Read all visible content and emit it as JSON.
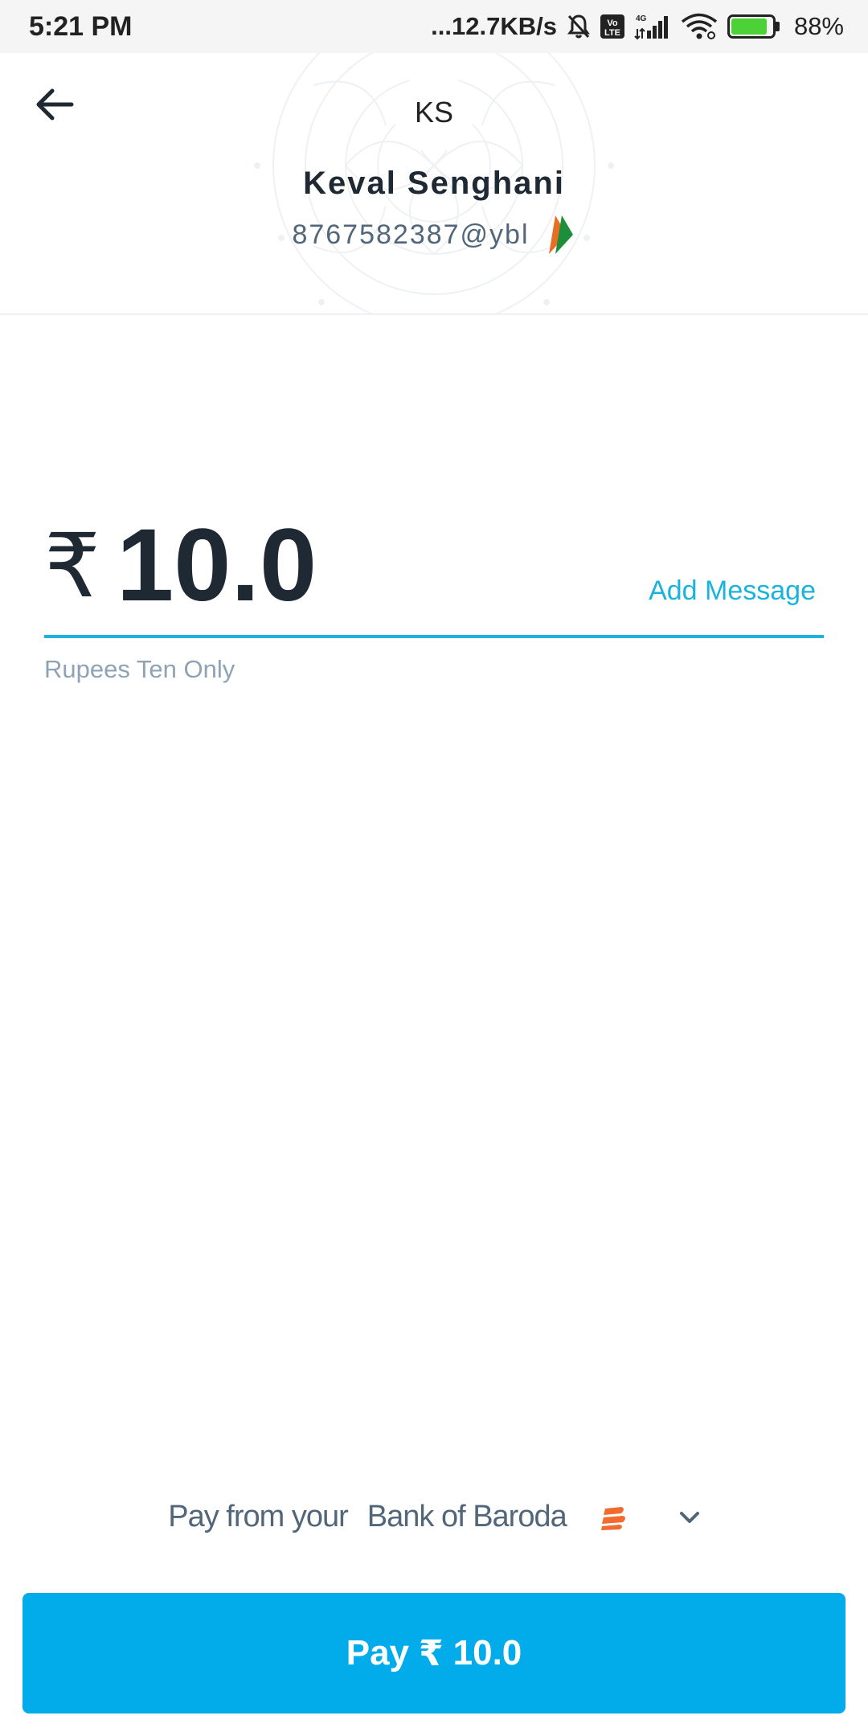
{
  "status_bar": {
    "time": "5:21 PM",
    "speed": "...12.7KB/s",
    "network": "4G",
    "lte": "Vo LTE",
    "battery_percent": "88%",
    "battery_level": 0.88,
    "icons": [
      "mute-bell-icon",
      "volte-icon",
      "signal-icon",
      "wifi-icon",
      "battery-charging-icon"
    ]
  },
  "header": {
    "back_icon": "arrow-left-icon",
    "avatar_initials": "KS",
    "payee_name": "Keval Senghani",
    "payee_vpa": "8767582387@ybl",
    "upi_icon": "upi-logo-icon"
  },
  "amount": {
    "currency_symbol": "₹",
    "value": "10.0",
    "add_message_label": "Add Message",
    "in_words": "Rupees Ten Only",
    "accent_color": "#1ab3dd"
  },
  "payment_source": {
    "prefix": "Pay from your",
    "bank_name": "Bank of Baroda",
    "bank_icon": "bank-of-baroda-logo-icon",
    "dropdown_icon": "chevron-down-icon"
  },
  "pay_button": {
    "label_prefix": "Pay",
    "currency_symbol": "₹",
    "amount": "10.0",
    "color": "#02abe9"
  }
}
